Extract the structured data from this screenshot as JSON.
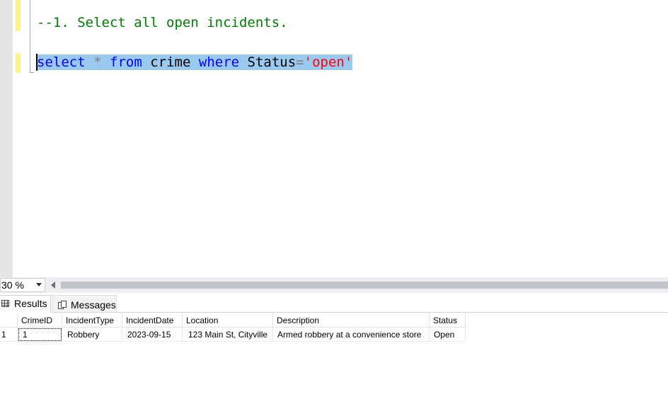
{
  "editor": {
    "comment_line": "--1. Select all open incidents.",
    "query": {
      "select_kw": "select",
      "star": "*",
      "from_kw": "from",
      "table": "crime",
      "where_kw": "where",
      "column": "Status",
      "equals": "=",
      "value": "'open'"
    }
  },
  "zoom": {
    "value": "30 %"
  },
  "tabs": {
    "results": "Results",
    "messages": "Messages"
  },
  "grid": {
    "columns": [
      "CrimeID",
      "IncidentType",
      "IncidentDate",
      "Location",
      "Description",
      "Status"
    ],
    "rows": [
      {
        "row_number": "1",
        "cells": [
          "1",
          "Robbery",
          "2023-09-15",
          "123 Main St, Cityville",
          "Armed robbery at a convenience store",
          "Open"
        ]
      }
    ]
  },
  "colors": {
    "comment": "#008000",
    "keyword": "#0000ff",
    "string": "#ff0000",
    "selection": "#99c9ef",
    "change_bar": "#fff48a"
  }
}
